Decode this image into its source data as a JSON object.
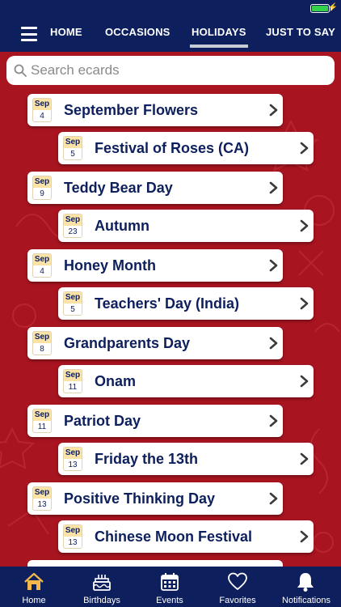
{
  "colors": {
    "navy": "#0d1f5c",
    "red_background": "#a8141f",
    "accent_gold": "#f2b84b",
    "battery_green": "#35d14a"
  },
  "nav": {
    "menu_icon": "hamburger-icon",
    "tabs": [
      {
        "label": "HOME"
      },
      {
        "label": "OCCASIONS"
      },
      {
        "label": "HOLIDAYS"
      },
      {
        "label": "JUST TO SAY"
      }
    ],
    "active_tab": "HOLIDAYS"
  },
  "search": {
    "placeholder": "Search ecards",
    "value": ""
  },
  "holidays": [
    {
      "month": "Sep",
      "day": "4",
      "title": "September Flowers"
    },
    {
      "month": "Sep",
      "day": "5",
      "title": "Festival of Roses (CA)"
    },
    {
      "month": "Sep",
      "day": "9",
      "title": "Teddy Bear Day"
    },
    {
      "month": "Sep",
      "day": "23",
      "title": "Autumn"
    },
    {
      "month": "Sep",
      "day": "4",
      "title": "Honey Month"
    },
    {
      "month": "Sep",
      "day": "5",
      "title": "Teachers' Day (India)"
    },
    {
      "month": "Sep",
      "day": "8",
      "title": "Grandparents Day"
    },
    {
      "month": "Sep",
      "day": "11",
      "title": "Onam"
    },
    {
      "month": "Sep",
      "day": "11",
      "title": "Patriot Day"
    },
    {
      "month": "Sep",
      "day": "13",
      "title": "Friday the 13th"
    },
    {
      "month": "Sep",
      "day": "13",
      "title": "Positive Thinking Day"
    },
    {
      "month": "Sep",
      "day": "13",
      "title": "Chinese Moon Festival"
    }
  ],
  "tabbar": [
    {
      "label": "Home",
      "icon": "home-icon",
      "active": true
    },
    {
      "label": "Birthdays",
      "icon": "cake-icon",
      "active": false
    },
    {
      "label": "Events",
      "icon": "calendar-icon",
      "active": false
    },
    {
      "label": "Favorites",
      "icon": "heart-icon",
      "active": false
    },
    {
      "label": "Notifications",
      "icon": "bell-icon",
      "active": false
    }
  ]
}
